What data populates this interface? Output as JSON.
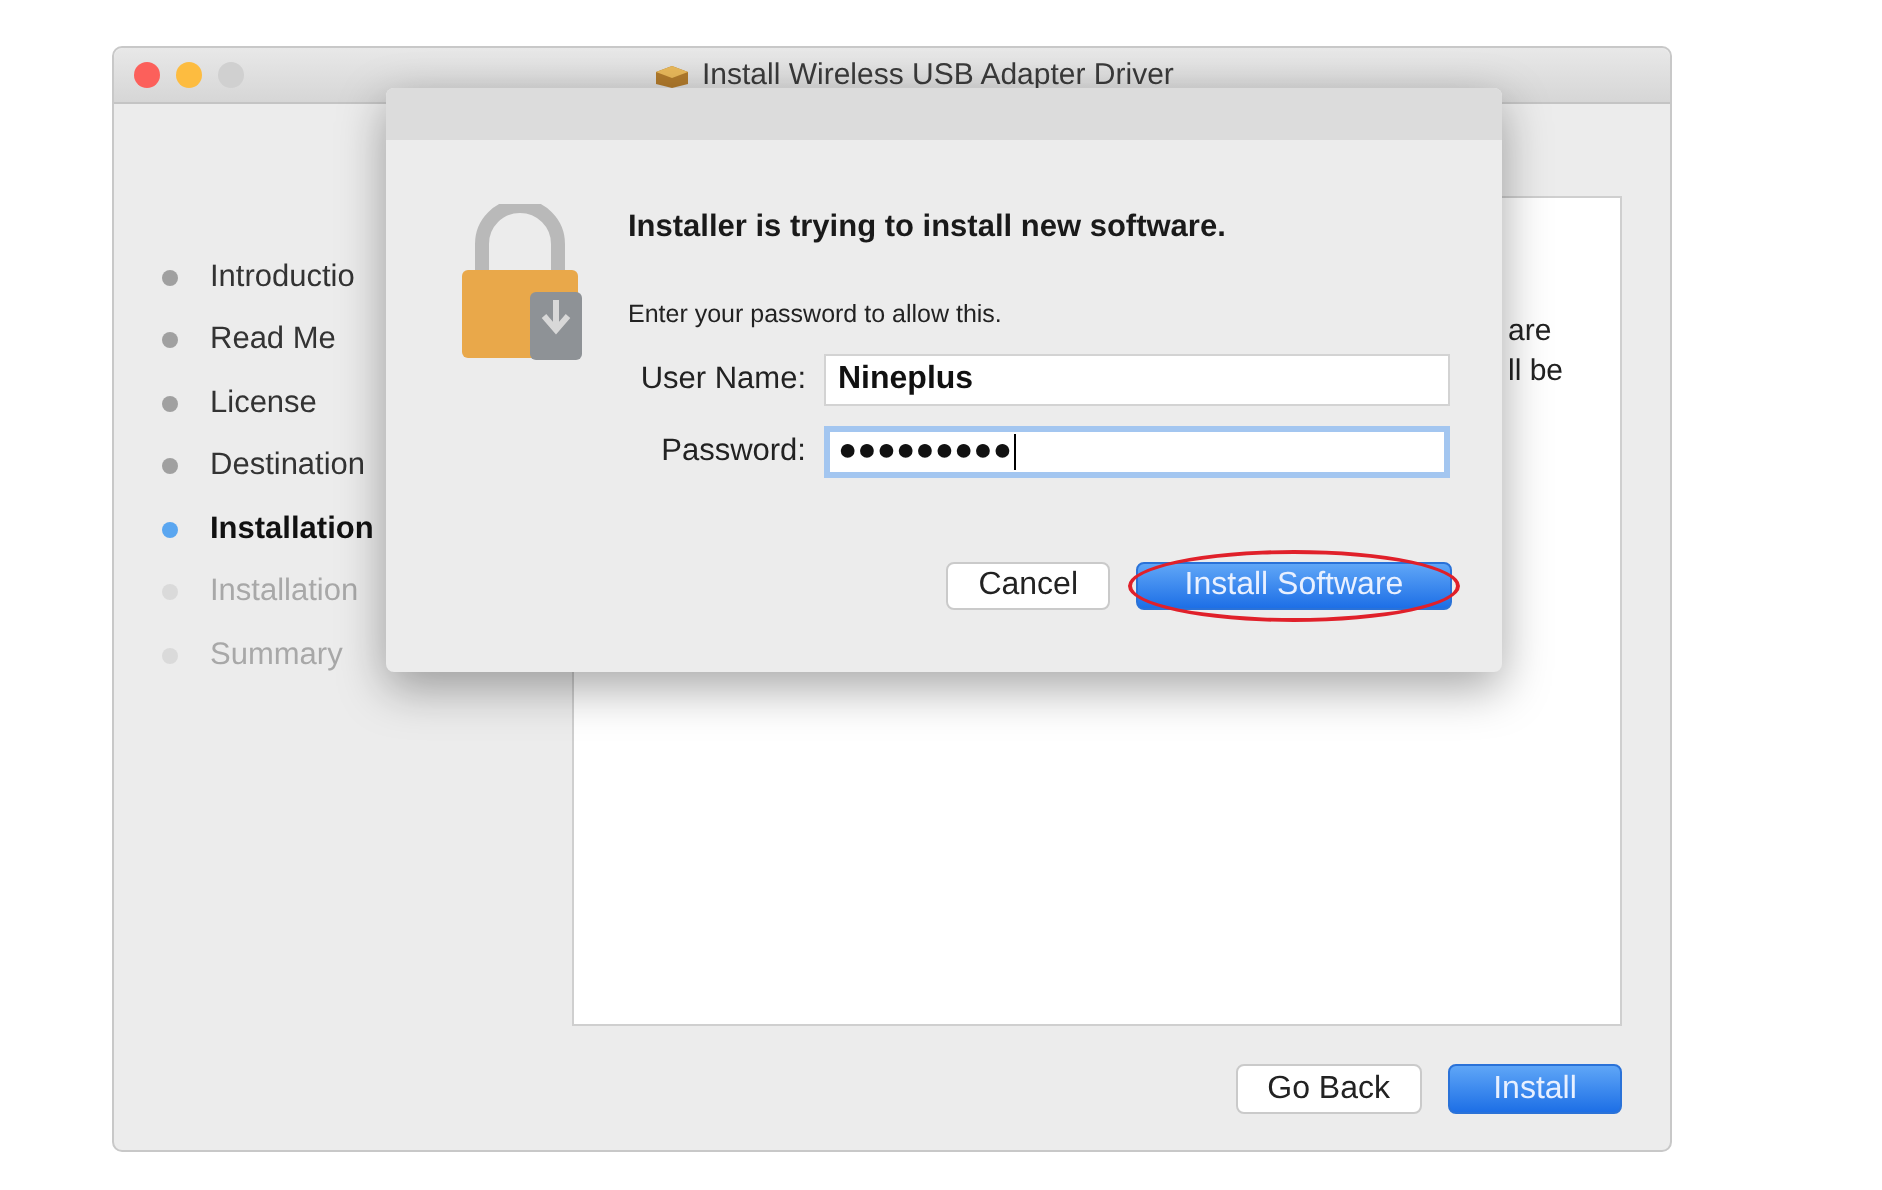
{
  "window": {
    "title": "Install Wireless USB Adapter Driver",
    "buttons": [
      {
        "kind": "close"
      },
      {
        "kind": "minimize"
      },
      {
        "kind": "zoom",
        "disabled": true
      }
    ]
  },
  "steps": [
    {
      "label": "Introductio",
      "completed": true,
      "selected": false
    },
    {
      "label": "Read Me",
      "completed": true,
      "selected": false
    },
    {
      "label": "License",
      "completed": true,
      "selected": false
    },
    {
      "label": "Destination",
      "completed": true,
      "selected": false
    },
    {
      "label": "Installation",
      "completed": true,
      "selected": true
    },
    {
      "label": "Installation",
      "completed": false,
      "selected": false
    },
    {
      "label": "Summary",
      "completed": false,
      "selected": false
    }
  ],
  "panel": {
    "lines": [
      "are",
      "ll be"
    ]
  },
  "buttons": [
    {
      "label": "Go Back",
      "kind": "secondary"
    },
    {
      "label": "Install",
      "kind": "primary"
    }
  ],
  "dialog": {
    "heading": "Installer is trying to install new software.",
    "message": "Enter your password to allow this.",
    "fields": [
      {
        "label": "User Name:",
        "value": "Nineplus",
        "focused": false
      },
      {
        "label": "Password:",
        "value": "●●●●●●●●●",
        "focused": true
      }
    ],
    "buttons": [
      {
        "label": "Cancel",
        "kind": "secondary",
        "circled": false
      },
      {
        "label": "Install Software",
        "kind": "primary",
        "circled": true
      }
    ]
  }
}
